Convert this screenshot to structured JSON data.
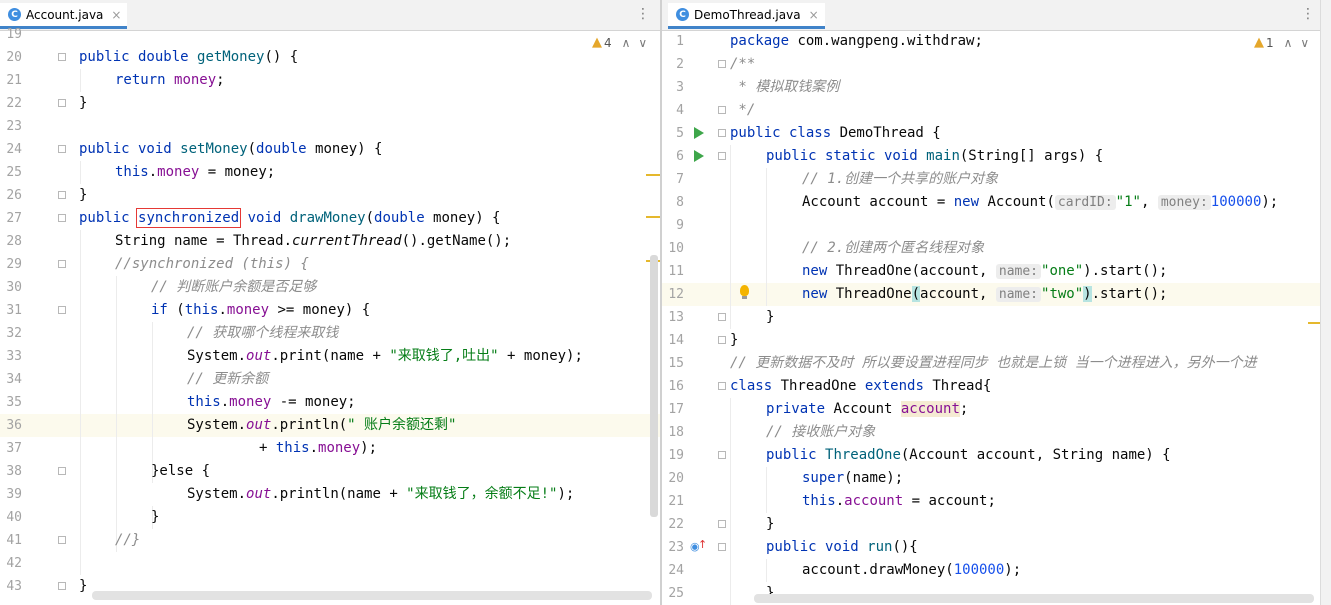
{
  "left": {
    "tab": {
      "icon": "C",
      "name": "Account.java",
      "close": "×"
    },
    "menu_icon": "⋮",
    "warnings": {
      "icon": "▲",
      "count": "4",
      "arrows": "∧∨"
    },
    "lines": [
      {
        "num": "19"
      },
      {
        "num": "20"
      },
      {
        "num": "21"
      },
      {
        "num": "22"
      },
      {
        "num": "23"
      },
      {
        "num": "24"
      },
      {
        "num": "25"
      },
      {
        "num": "26"
      },
      {
        "num": "27"
      },
      {
        "num": "28"
      },
      {
        "num": "29"
      },
      {
        "num": "30"
      },
      {
        "num": "31"
      },
      {
        "num": "32"
      },
      {
        "num": "33"
      },
      {
        "num": "34"
      },
      {
        "num": "35"
      },
      {
        "num": "36"
      },
      {
        "num": "37"
      },
      {
        "num": "38"
      },
      {
        "num": "39"
      },
      {
        "num": "40"
      },
      {
        "num": "41"
      },
      {
        "num": "42"
      },
      {
        "num": "43"
      }
    ],
    "tok": {
      "l20_kw": "public double ",
      "l20_fn": "getMoney",
      "l20_rest": "() {",
      "l21_kw": "return ",
      "l21_fld": "money",
      "l21_rest": ";",
      "l22": "}",
      "l24_kw": "public void ",
      "l24_fn": "setMoney",
      "l24_p1": "(",
      "l24_kw2": "double",
      "l24_rest": " money) {",
      "l25_kw": "this",
      "l25_dot": ".",
      "l25_fld": "money",
      "l25_rest": " = money;",
      "l26": "}",
      "l27_kw": "public ",
      "l27_sync": "synchronized",
      "l27_kw2": " void ",
      "l27_fn": "drawMoney",
      "l27_p1": "(",
      "l27_kw3": "double",
      "l27_rest": " money) {",
      "l28_a": "String name = Thread.",
      "l28_it": "currentThread",
      "l28_b": "().getName();",
      "l29_cm": "//synchronized (this) {",
      "l30_cm": "// 判断账户余额是否足够",
      "l31_kw": "if ",
      "l31_p": "(",
      "l31_kw2": "this",
      "l31_dot": ".",
      "l31_fld": "money",
      "l31_rest": " >= money) {",
      "l32_cm": "// 获取哪个线程来取钱",
      "l33_a": "System.",
      "l33_out": "out",
      "l33_b": ".print(name + ",
      "l33_str": "\"来取钱了,吐出\"",
      "l33_c": " + money);",
      "l34_cm": "// 更新余额",
      "l35_kw": "this",
      "l35_dot": ".",
      "l35_fld": "money",
      "l35_rest": " -= money;",
      "l36_a": "System.",
      "l36_out": "out",
      "l36_b": ".println(",
      "l36_str": "\" 账户余额还剩\"",
      "l37_a": "+ ",
      "l37_kw": "this",
      "l37_dot": ".",
      "l37_fld": "money",
      "l37_rest": ");",
      "l38": "}else {",
      "l39_a": "System.",
      "l39_out": "out",
      "l39_b": ".println(name + ",
      "l39_str": "\"来取钱了，余额不足!\"",
      "l39_c": ");",
      "l40": "}",
      "l41_cm": "//}",
      "l43": "}"
    }
  },
  "right": {
    "tab": {
      "icon": "C",
      "name": "DemoThread.java",
      "close": "×"
    },
    "menu_icon": "⋮",
    "warnings": {
      "icon": "▲",
      "count": "1",
      "arrows": "∧∨"
    },
    "lines": [
      {
        "num": "1"
      },
      {
        "num": "2"
      },
      {
        "num": "3"
      },
      {
        "num": "4"
      },
      {
        "num": "5"
      },
      {
        "num": "6"
      },
      {
        "num": "7"
      },
      {
        "num": "8"
      },
      {
        "num": "9"
      },
      {
        "num": "10"
      },
      {
        "num": "11"
      },
      {
        "num": "12"
      },
      {
        "num": "13"
      },
      {
        "num": "14"
      },
      {
        "num": "15"
      },
      {
        "num": "16"
      },
      {
        "num": "17"
      },
      {
        "num": "18"
      },
      {
        "num": "19"
      },
      {
        "num": "20"
      },
      {
        "num": "21"
      },
      {
        "num": "22"
      },
      {
        "num": "23"
      },
      {
        "num": "24"
      },
      {
        "num": "25"
      }
    ],
    "tok": {
      "r1_kw": "package ",
      "r1_rest": "com.wangpeng.withdraw;",
      "r2_cm": "/**",
      "r3_cm": " * 模拟取钱案例",
      "r4_cm": " */",
      "r5_kw": "public class ",
      "r5_rest": "DemoThread {",
      "r6_kw": "public static void ",
      "r6_fn": "main",
      "r6_rest": "(String[] args) {",
      "r7_cm": "// 1.创建一个共享的账户对象",
      "r8_a": "Account account = ",
      "r8_kw": "new ",
      "r8_b": "Account(",
      "r8_h1": "cardID:",
      "r8_s1": "\"1\"",
      "r8_c": ", ",
      "r8_h2": "money:",
      "r8_n": "100000",
      "r8_d": ");",
      "r10_cm": "// 2.创建两个匿名线程对象",
      "r11_kw": "new ",
      "r11_a": "ThreadOne(account, ",
      "r11_h": "name:",
      "r11_s": "\"one\"",
      "r11_b": ").start();",
      "r12_kw": "new ",
      "r12_a": "ThreadOne",
      "r12_p1": "(",
      "r12_a2": "account, ",
      "r12_h": "name:",
      "r12_s": "\"two\"",
      "r12_p2": ")",
      "r12_b": ".start();",
      "r13": "}",
      "r14": "}",
      "r15_cm": "// 更新数据不及时 所以要设置进程同步 也就是上锁 当一个进程进入，另外一个进",
      "r16_kw": "class ",
      "r16_a": "ThreadOne ",
      "r16_kw2": "extends ",
      "r16_b": "Thread{",
      "r17_kw": "private ",
      "r17_a": "Account ",
      "r17_fld": "account",
      "r17_b": ";",
      "r18_cm": "// 接收账户对象",
      "r19_kw": "public ",
      "r19_fn": "ThreadOne",
      "r19_rest": "(Account account, String name) {",
      "r20_kw": "super",
      "r20_rest": "(name);",
      "r21_kw": "this",
      "r21_dot": ".",
      "r21_fld": "account",
      "r21_rest": " = account;",
      "r22": "}",
      "r23_kw": "public void ",
      "r23_fn": "run",
      "r23_rest": "(){",
      "r24_a": "account.drawMoney(",
      "r24_n": "100000",
      "r24_b": ");",
      "r25": "}"
    }
  },
  "colors": {
    "keyword": "#0033b3",
    "field": "#871094",
    "method": "#00627a",
    "string": "#067d17",
    "number": "#1750eb",
    "comment": "#8c8c8c",
    "tab_underline": "#4083c9",
    "warning": "#e5a72b"
  }
}
